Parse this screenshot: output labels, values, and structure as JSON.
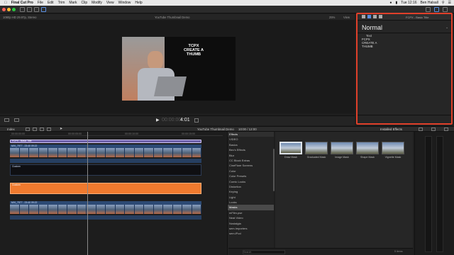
{
  "menubar": {
    "apple": "",
    "app": "Final Cut Pro",
    "items": [
      "File",
      "Edit",
      "Trim",
      "Mark",
      "Clip",
      "Modify",
      "View",
      "Window",
      "Help"
    ],
    "clock": "Tue 12:16",
    "user": "Ben Halsall"
  },
  "viewer": {
    "format": "1080p HD 29.97p, Stereo",
    "project": "YouTube Thumbnail Demo",
    "zoom": "25%",
    "view_label": "View",
    "timecode": "4:01",
    "timecode_prefix": "00:00:00",
    "overlay_text": "TCPX\nCREATE A\nTHUMB"
  },
  "inspector": {
    "title": "FCPX - Basic Title",
    "style": "Normal",
    "section": "Text",
    "text_value": "FCPX\nCREATE A\nTHUMB"
  },
  "timeline": {
    "index_label": "Index",
    "project": "YouTube Thumbnail Demo",
    "duration": "10:00 / 12:00",
    "ruler": [
      "00:00:00:00",
      "00:00:05:00",
      "00:00:10:00",
      "00:00:15:00"
    ],
    "clips": [
      {
        "label": "FCPX - Basic Title"
      },
      {
        "label": "MVI_7977 - 23:40 09:22"
      },
      {
        "label": "Custom"
      },
      {
        "label": "Custom"
      },
      {
        "label": "MVI_7977 - 23:40 09:22"
      }
    ]
  },
  "effects": {
    "header": "Effects",
    "installed": "Installed Effects",
    "categories": [
      "VIDEO",
      "Basics",
      "Bec's Effects",
      "Blur",
      "CC Block Extras",
      "CineFlare Screens",
      "Color",
      "Color Presets",
      "Comic Looks",
      "Distortion",
      "Keying",
      "Light",
      "Looks",
      "Masks",
      "mFilm.pse",
      "Neat Video",
      "Nostalgia",
      "sem.Importers",
      "sem.iPod"
    ],
    "selected_category": "Masks",
    "items": [
      "Draw Mask",
      "Graduated Mask",
      "Image Mask",
      "Shape Mask",
      "Vignette Mask"
    ],
    "search_placeholder": "Search",
    "count": "5 items"
  },
  "colors": {
    "accent_red": "#e0402a",
    "title_clip": "#6c5fa8",
    "video_clip": "#2c4a74",
    "custom_orange": "#f07a2e"
  }
}
